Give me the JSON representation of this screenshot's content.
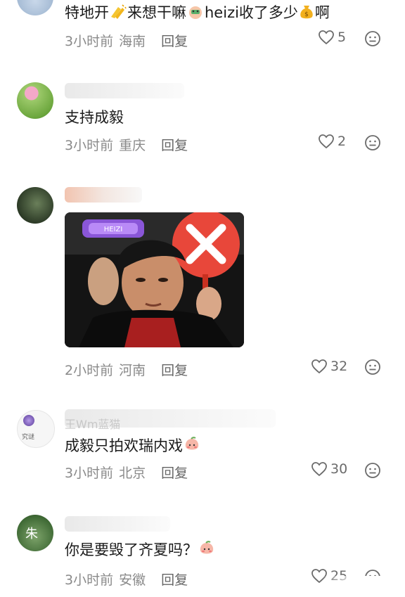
{
  "comments": [
    {
      "text_before": "特地开",
      "text_mid1": "来想干嘛",
      "text_mid2": "heizi收了多少",
      "text_after": "啊",
      "time": "3小时前",
      "location": "海南",
      "reply": "回复",
      "likes": "5"
    },
    {
      "text": "支持成毅",
      "time": "3小时前",
      "location": "重庆",
      "reply": "回复",
      "likes": "2"
    },
    {
      "image_sticker_label": "HEIZI",
      "time": "2小时前",
      "location": "河南",
      "reply": "回复",
      "likes": "32"
    },
    {
      "text": "成毅只拍欢瑞内戏",
      "time": "3小时前",
      "location": "北京",
      "reply": "回复",
      "likes": "30",
      "avatar_caption": "究谜",
      "username_partial": "王Wm蓝猫"
    },
    {
      "text": "你是要毁了齐夏吗？",
      "time": "3小时前",
      "location": "安徽",
      "reply": "回复",
      "likes": "25",
      "avatar_char": "朱"
    }
  ],
  "colors": {
    "accent_red": "#e8473a",
    "meta_gray": "#8a8a8a"
  }
}
